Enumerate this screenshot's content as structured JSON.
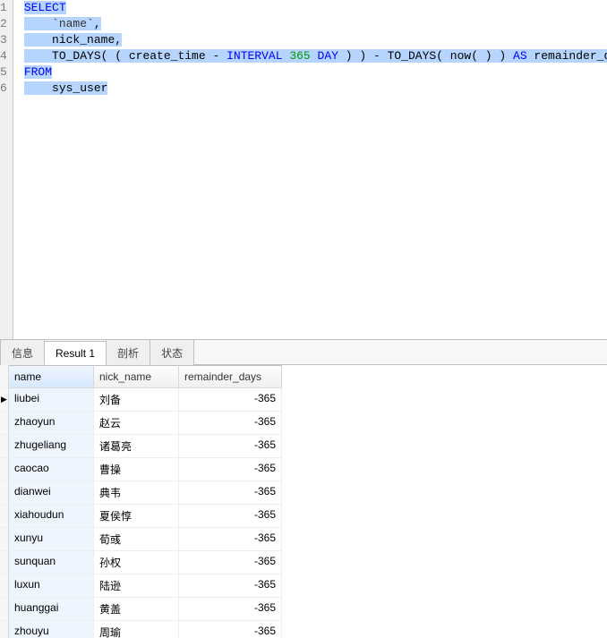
{
  "editor": {
    "lines": [
      {
        "num": "1",
        "tokens": [
          {
            "t": "SELECT",
            "cls": "kw sel"
          }
        ]
      },
      {
        "num": "2",
        "tokens": [
          {
            "t": "    ",
            "cls": "sel"
          },
          {
            "t": "`name`",
            "cls": "dark sel"
          },
          {
            "t": ",",
            "cls": "sel"
          }
        ]
      },
      {
        "num": "3",
        "tokens": [
          {
            "t": "    ",
            "cls": "sel"
          },
          {
            "t": "nick_name",
            "cls": "id sel"
          },
          {
            "t": ",",
            "cls": "sel"
          }
        ]
      },
      {
        "num": "4",
        "tokens": [
          {
            "t": "    ",
            "cls": "sel"
          },
          {
            "t": "TO_DAYS",
            "cls": "id sel"
          },
          {
            "t": "( ( create_time ",
            "cls": "sel"
          },
          {
            "t": "-",
            "cls": "sel"
          },
          {
            "t": " ",
            "cls": "sel"
          },
          {
            "t": "INTERVAL",
            "cls": "kw sel"
          },
          {
            "t": " ",
            "cls": "sel"
          },
          {
            "t": "365",
            "cls": "num sel"
          },
          {
            "t": " ",
            "cls": "sel"
          },
          {
            "t": "DAY",
            "cls": "kw sel"
          },
          {
            "t": " ) ) ",
            "cls": "sel"
          },
          {
            "t": "-",
            "cls": "sel"
          },
          {
            "t": " TO_DAYS( now( ) ) ",
            "cls": "sel"
          },
          {
            "t": "AS",
            "cls": "kw sel"
          },
          {
            "t": " remainder_days",
            "cls": "sel"
          },
          {
            "t": " ",
            "cls": ""
          }
        ]
      },
      {
        "num": "5",
        "tokens": [
          {
            "t": "FROM",
            "cls": "kw sel"
          }
        ]
      },
      {
        "num": "6",
        "tokens": [
          {
            "t": "    ",
            "cls": "sel"
          },
          {
            "t": "sys_user",
            "cls": "id sel"
          }
        ]
      }
    ]
  },
  "tabs": {
    "items": [
      {
        "label": "信息",
        "active": false
      },
      {
        "label": "Result 1",
        "active": true
      },
      {
        "label": "剖析",
        "active": false
      },
      {
        "label": "状态",
        "active": false
      }
    ]
  },
  "grid": {
    "columns": [
      "name",
      "nick_name",
      "remainder_days"
    ],
    "selected_col": 0,
    "rows": [
      {
        "name": "liubei",
        "nick_name": "刘备",
        "remainder_days": "-365"
      },
      {
        "name": "zhaoyun",
        "nick_name": "赵云",
        "remainder_days": "-365"
      },
      {
        "name": "zhugeliang",
        "nick_name": "诸葛亮",
        "remainder_days": "-365"
      },
      {
        "name": "caocao",
        "nick_name": "曹操",
        "remainder_days": "-365"
      },
      {
        "name": "dianwei",
        "nick_name": "典韦",
        "remainder_days": "-365"
      },
      {
        "name": "xiahoudun",
        "nick_name": "夏侯惇",
        "remainder_days": "-365"
      },
      {
        "name": "xunyu",
        "nick_name": "荀彧",
        "remainder_days": "-365"
      },
      {
        "name": "sunquan",
        "nick_name": "孙权",
        "remainder_days": "-365"
      },
      {
        "name": "luxun",
        "nick_name": "陆逊",
        "remainder_days": "-365"
      },
      {
        "name": "huanggai",
        "nick_name": "黄盖",
        "remainder_days": "-365"
      },
      {
        "name": "zhouyu",
        "nick_name": "周瑜",
        "remainder_days": "-365"
      }
    ]
  }
}
